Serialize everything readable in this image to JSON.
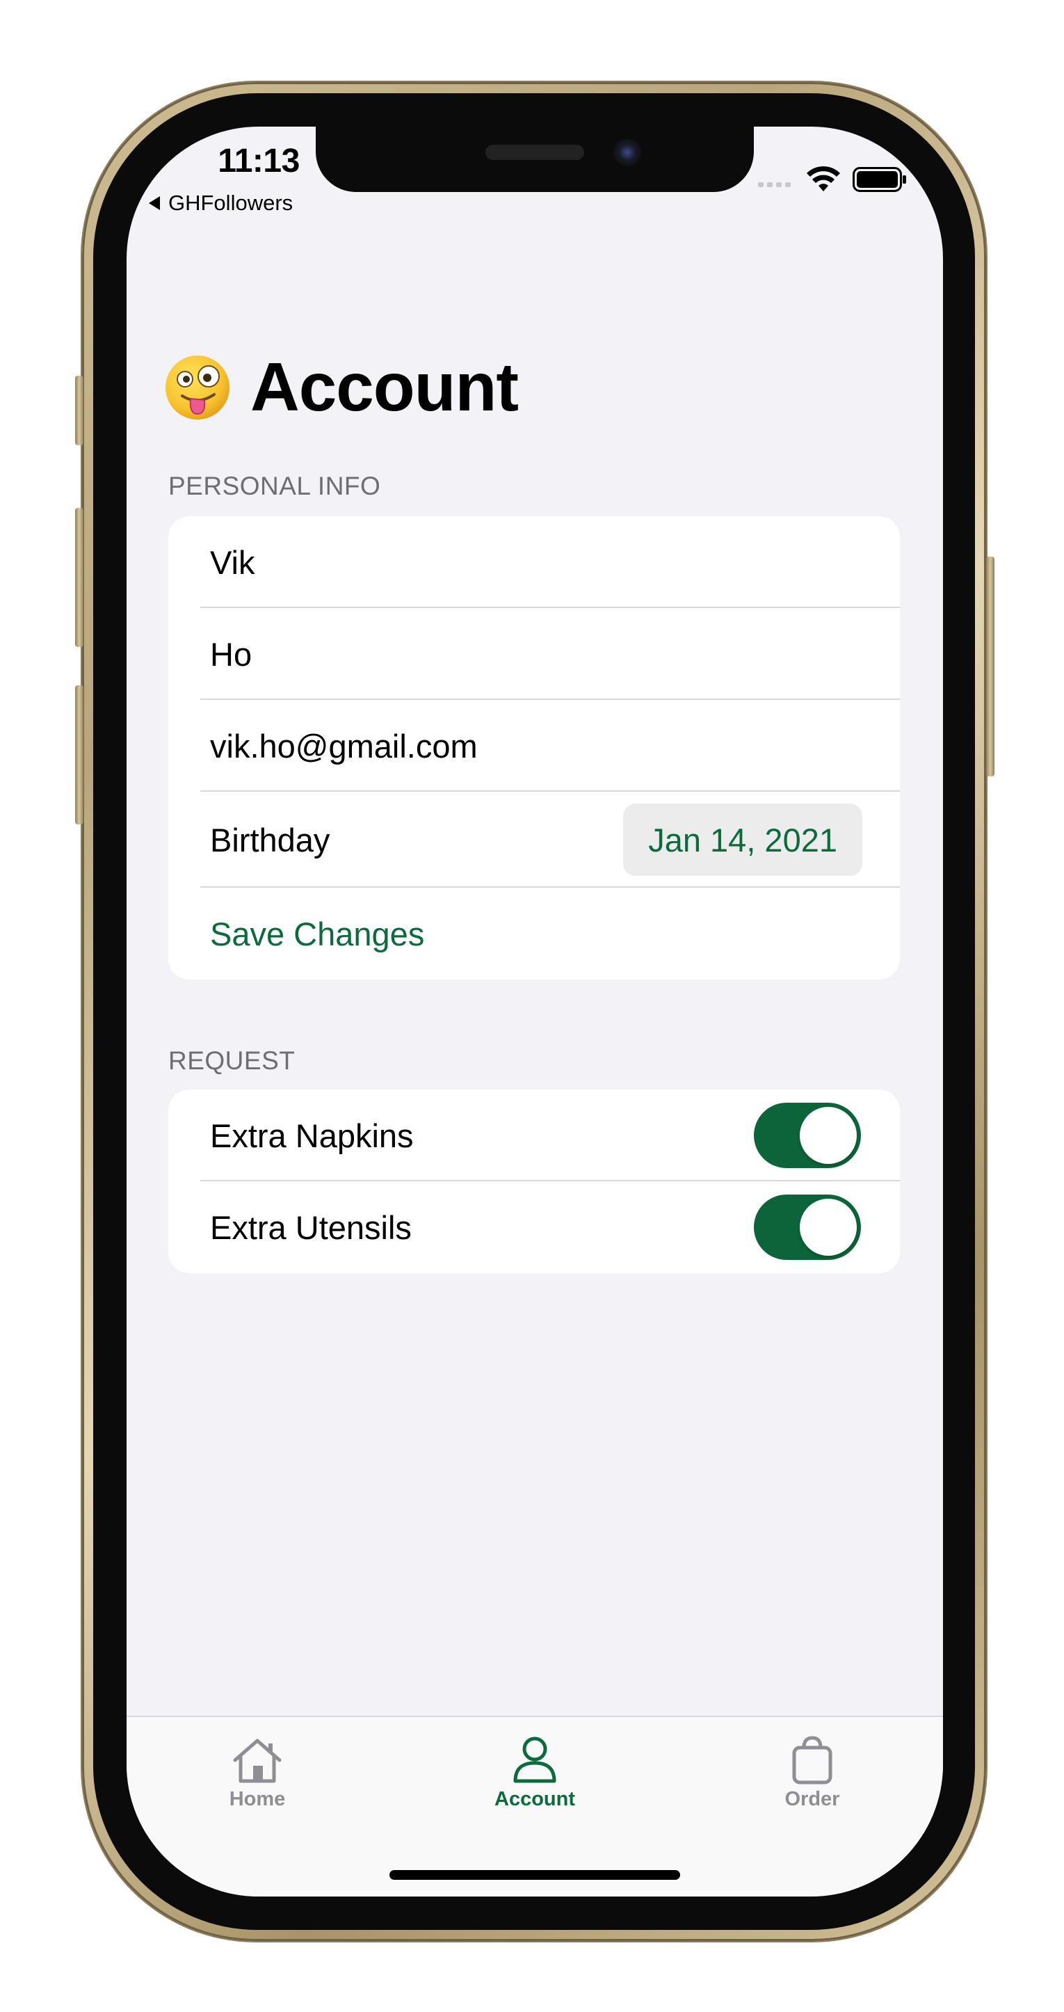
{
  "status_bar": {
    "time": "11:13",
    "back_app": "GHFollowers"
  },
  "header": {
    "emoji": "🤪",
    "title": "Account"
  },
  "personal_info": {
    "header": "PERSONAL INFO",
    "first_name": "Vik",
    "last_name": "Ho",
    "email": "vik.ho@gmail.com",
    "birthday_label": "Birthday",
    "birthday_value": "Jan 14, 2021",
    "save_label": "Save Changes"
  },
  "request": {
    "header": "REQUEST",
    "items": [
      {
        "label": "Extra Napkins",
        "on": true
      },
      {
        "label": "Extra Utensils",
        "on": true
      }
    ]
  },
  "tabs": [
    {
      "label": "Home",
      "icon": "house-icon",
      "active": false
    },
    {
      "label": "Account",
      "icon": "person-icon",
      "active": true
    },
    {
      "label": "Order",
      "icon": "bag-icon",
      "active": false
    }
  ],
  "colors": {
    "accent": "#0c6b3d",
    "background": "#f2f2f7",
    "frame": "#c8b68c"
  }
}
